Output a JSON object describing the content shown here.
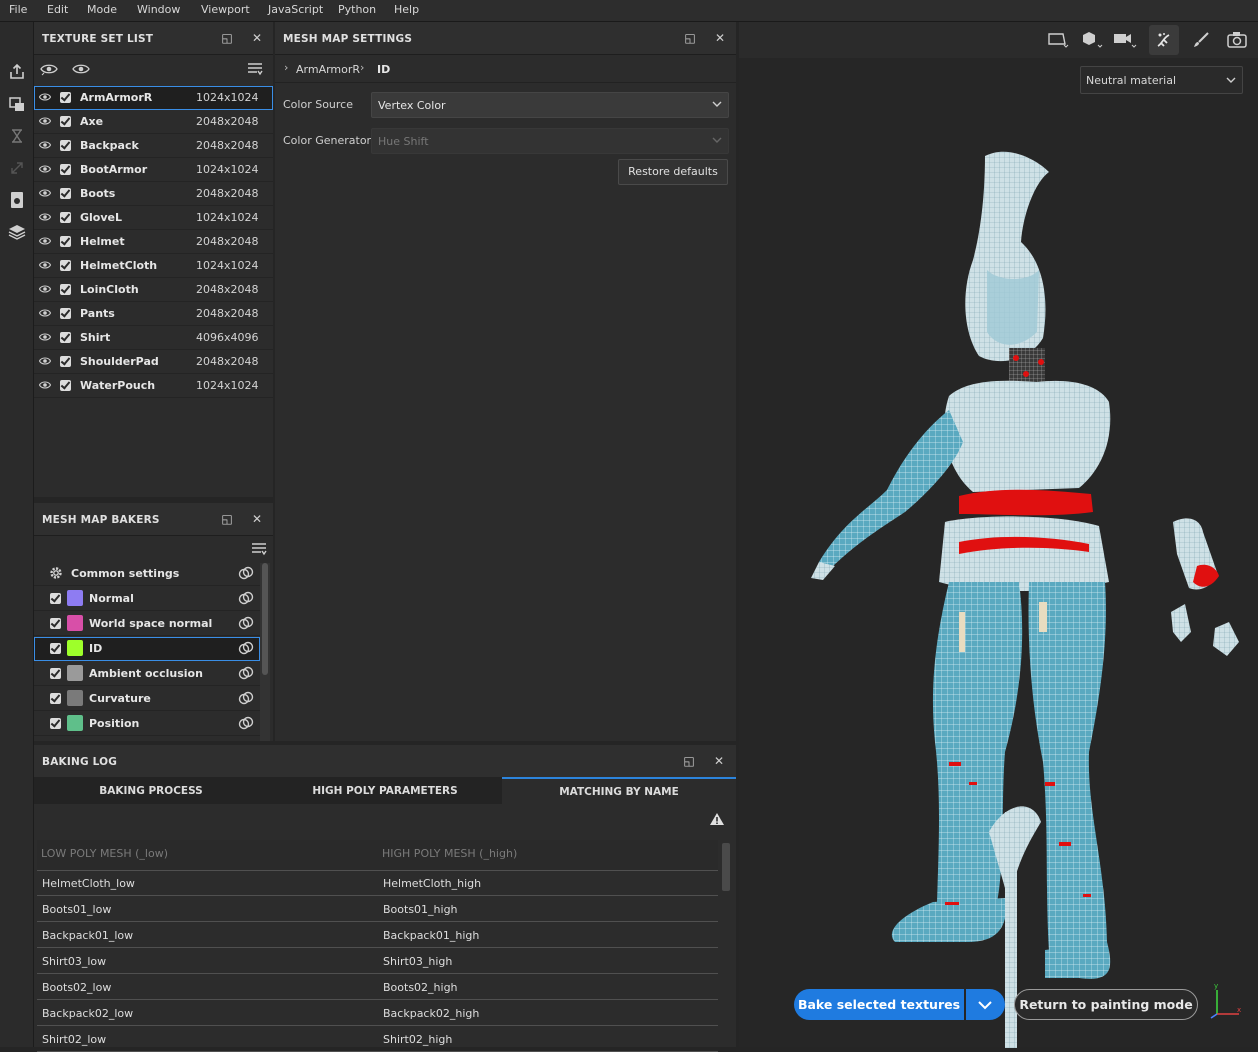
{
  "menubar": [
    "File",
    "Edit",
    "Mode",
    "Window",
    "Viewport",
    "JavaScript",
    "Python",
    "Help"
  ],
  "texture_set_list": {
    "title": "TEXTURE SET LIST",
    "items": [
      {
        "name": "ArmArmorR",
        "res": "1024x1024",
        "selected": true
      },
      {
        "name": "Axe",
        "res": "2048x2048"
      },
      {
        "name": "Backpack",
        "res": "2048x2048"
      },
      {
        "name": "BootArmor",
        "res": "1024x1024"
      },
      {
        "name": "Boots",
        "res": "2048x2048"
      },
      {
        "name": "GloveL",
        "res": "1024x1024"
      },
      {
        "name": "Helmet",
        "res": "2048x2048"
      },
      {
        "name": "HelmetCloth",
        "res": "1024x1024"
      },
      {
        "name": "LoinCloth",
        "res": "2048x2048"
      },
      {
        "name": "Pants",
        "res": "2048x2048"
      },
      {
        "name": "Shirt",
        "res": "4096x4096"
      },
      {
        "name": "ShoulderPad",
        "res": "2048x2048"
      },
      {
        "name": "WaterPouch",
        "res": "1024x1024"
      }
    ]
  },
  "mesh_map_settings": {
    "title": "MESH MAP SETTINGS",
    "breadcrumb": [
      "ArmArmorR",
      "ID"
    ],
    "color_source_label": "Color Source",
    "color_source_value": "Vertex Color",
    "color_generator_label": "Color Generator",
    "color_generator_value": "Hue Shift",
    "restore_label": "Restore defaults"
  },
  "mesh_map_bakers": {
    "title": "MESH MAP BAKERS",
    "common": "Common settings",
    "items": [
      {
        "name": "Normal",
        "icon_color": "#8e7cf2"
      },
      {
        "name": "World space normal",
        "icon_color": "#d84fa8"
      },
      {
        "name": "ID",
        "icon_color": "#9eff2a",
        "selected": true
      },
      {
        "name": "Ambient occlusion",
        "icon_color": "#9a9a9a"
      },
      {
        "name": "Curvature",
        "icon_color": "#7a7a7a"
      },
      {
        "name": "Position",
        "icon_color": "#5fbf8a"
      }
    ]
  },
  "baking_log": {
    "title": "BAKING LOG",
    "tabs": [
      "BAKING PROCESS",
      "HIGH POLY PARAMETERS",
      "MATCHING BY NAME"
    ],
    "active_tab": 2,
    "col_low": "LOW POLY MESH (_low)",
    "col_high": "HIGH POLY MESH (_high)",
    "rows": [
      [
        "HelmetCloth_low",
        "HelmetCloth_high"
      ],
      [
        "Boots01_low",
        "Boots01_high"
      ],
      [
        "Backpack01_low",
        "Backpack01_high"
      ],
      [
        "Shirt03_low",
        "Shirt03_high"
      ],
      [
        "Boots02_low",
        "Boots02_high"
      ],
      [
        "Backpack02_low",
        "Backpack02_high"
      ],
      [
        "Shirt02_low",
        "Shirt02_high"
      ]
    ]
  },
  "viewport": {
    "material": "Neutral material",
    "bake_button": "Bake selected textures",
    "return_button": "Return to painting mode",
    "accent": "#1f7be0",
    "mesh_color": "#5aa9c0",
    "highlight_color": "#e01010"
  }
}
